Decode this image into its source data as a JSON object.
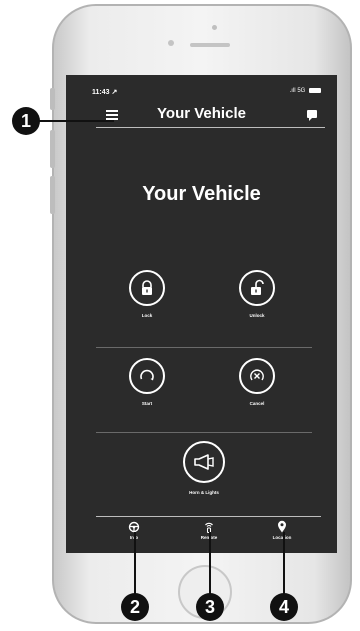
{
  "status_bar": {
    "time": "11:43 ↗",
    "signal": "5G"
  },
  "header": {
    "title": "Your Vehicle",
    "menu_icon": "hamburger-icon",
    "message_icon": "chat-icon"
  },
  "main": {
    "title": "Your Vehicle",
    "controls": [
      {
        "label": "Lock",
        "icon": "lock-icon"
      },
      {
        "label": "Unlock",
        "icon": "unlock-icon"
      },
      {
        "label": "Start",
        "icon": "start-icon"
      },
      {
        "label": "Cancel",
        "icon": "cancel-icon"
      },
      {
        "label": "Horn & Lights",
        "icon": "horn-icon"
      }
    ]
  },
  "tabs": [
    {
      "label": "Info",
      "icon": "steering-wheel-icon"
    },
    {
      "label": "Remote",
      "icon": "remote-icon"
    },
    {
      "label": "Location",
      "icon": "location-pin-icon"
    }
  ],
  "callouts": [
    "1",
    "2",
    "3",
    "4"
  ],
  "colors": {
    "screen_bg": "#2b2b2b",
    "foreground": "#ffffff",
    "callout_bg": "#111111"
  }
}
